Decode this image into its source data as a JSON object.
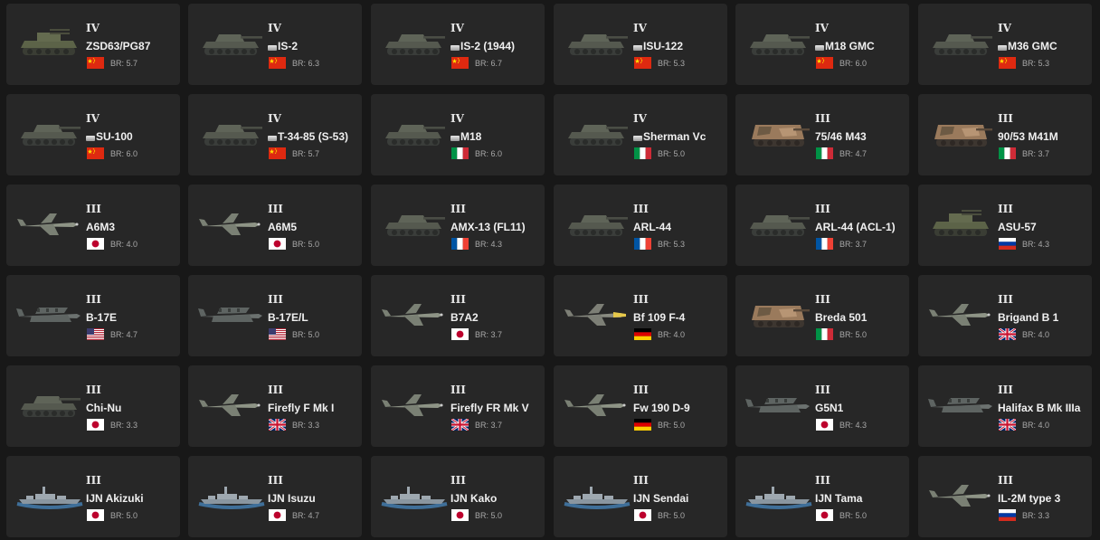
{
  "vehicles": [
    {
      "rank": "IV",
      "name": "ZSD63/PG87",
      "br": "BR: 5.7",
      "country": "china",
      "premium": false,
      "type": "tank-spaa"
    },
    {
      "rank": "IV",
      "name": "IS-2",
      "br": "BR: 6.3",
      "country": "china",
      "premium": true,
      "type": "tank"
    },
    {
      "rank": "IV",
      "name": "IS-2 (1944)",
      "br": "BR: 6.7",
      "country": "china",
      "premium": true,
      "type": "tank"
    },
    {
      "rank": "IV",
      "name": "ISU-122",
      "br": "BR: 5.3",
      "country": "china",
      "premium": true,
      "type": "tank"
    },
    {
      "rank": "IV",
      "name": "M18 GMC",
      "br": "BR: 6.0",
      "country": "china",
      "premium": true,
      "type": "tank"
    },
    {
      "rank": "IV",
      "name": "M36 GMC",
      "br": "BR: 5.3",
      "country": "china",
      "premium": true,
      "type": "tank"
    },
    {
      "rank": "IV",
      "name": "SU-100",
      "br": "BR: 6.0",
      "country": "china",
      "premium": true,
      "type": "tank"
    },
    {
      "rank": "IV",
      "name": "T-34-85 (S-53)",
      "br": "BR: 5.7",
      "country": "china",
      "premium": true,
      "type": "tank"
    },
    {
      "rank": "IV",
      "name": "M18",
      "br": "BR: 6.0",
      "country": "italy",
      "premium": true,
      "type": "tank"
    },
    {
      "rank": "IV",
      "name": "Sherman Vc",
      "br": "BR: 5.0",
      "country": "italy",
      "premium": true,
      "type": "tank"
    },
    {
      "rank": "III",
      "name": "75/46 M43",
      "br": "BR: 4.7",
      "country": "italy",
      "premium": false,
      "type": "tank-camo"
    },
    {
      "rank": "III",
      "name": "90/53 M41M",
      "br": "BR: 3.7",
      "country": "italy",
      "premium": false,
      "type": "tank-camo"
    },
    {
      "rank": "III",
      "name": "A6M3",
      "br": "BR: 4.0",
      "country": "japan",
      "premium": false,
      "type": "plane"
    },
    {
      "rank": "III",
      "name": "A6M5",
      "br": "BR: 5.0",
      "country": "japan",
      "premium": false,
      "type": "plane"
    },
    {
      "rank": "III",
      "name": "AMX-13 (FL11)",
      "br": "BR: 4.3",
      "country": "france",
      "premium": false,
      "type": "tank"
    },
    {
      "rank": "III",
      "name": "ARL-44",
      "br": "BR: 5.3",
      "country": "france",
      "premium": false,
      "type": "tank"
    },
    {
      "rank": "III",
      "name": "ARL-44 (ACL-1)",
      "br": "BR: 3.7",
      "country": "france",
      "premium": false,
      "type": "tank"
    },
    {
      "rank": "III",
      "name": "ASU-57",
      "br": "BR: 4.3",
      "country": "russia",
      "premium": false,
      "type": "tank-spaa"
    },
    {
      "rank": "III",
      "name": "B-17E",
      "br": "BR: 4.7",
      "country": "usa",
      "premium": false,
      "type": "bomber"
    },
    {
      "rank": "III",
      "name": "B-17E/L",
      "br": "BR: 5.0",
      "country": "usa",
      "premium": false,
      "type": "bomber"
    },
    {
      "rank": "III",
      "name": "B7A2",
      "br": "BR: 3.7",
      "country": "japan",
      "premium": false,
      "type": "plane"
    },
    {
      "rank": "III",
      "name": "Bf 109 F-4",
      "br": "BR: 4.0",
      "country": "germany",
      "premium": false,
      "type": "plane-yellow"
    },
    {
      "rank": "III",
      "name": "Breda 501",
      "br": "BR: 5.0",
      "country": "italy",
      "premium": false,
      "type": "tank-camo"
    },
    {
      "rank": "III",
      "name": "Brigand B 1",
      "br": "BR: 4.0",
      "country": "uk",
      "premium": false,
      "type": "plane"
    },
    {
      "rank": "III",
      "name": "Chi-Nu",
      "br": "BR: 3.3",
      "country": "japan",
      "premium": false,
      "type": "tank"
    },
    {
      "rank": "III",
      "name": "Firefly F Mk I",
      "br": "BR: 3.3",
      "country": "uk",
      "premium": false,
      "type": "plane"
    },
    {
      "rank": "III",
      "name": "Firefly FR Mk V",
      "br": "BR: 3.7",
      "country": "uk",
      "premium": false,
      "type": "plane"
    },
    {
      "rank": "III",
      "name": "Fw 190 D-9",
      "br": "BR: 5.0",
      "country": "germany",
      "premium": false,
      "type": "plane"
    },
    {
      "rank": "III",
      "name": "G5N1",
      "br": "BR: 4.3",
      "country": "japan",
      "premium": false,
      "type": "bomber"
    },
    {
      "rank": "III",
      "name": "Halifax B Mk IIIa",
      "br": "BR: 4.0",
      "country": "uk",
      "premium": false,
      "type": "bomber"
    },
    {
      "rank": "III",
      "name": "IJN Akizuki",
      "br": "BR: 5.0",
      "country": "japan",
      "premium": false,
      "type": "ship"
    },
    {
      "rank": "III",
      "name": "IJN Isuzu",
      "br": "BR: 4.7",
      "country": "japan",
      "premium": false,
      "type": "ship"
    },
    {
      "rank": "III",
      "name": "IJN Kako",
      "br": "BR: 5.0",
      "country": "japan",
      "premium": false,
      "type": "ship"
    },
    {
      "rank": "III",
      "name": "IJN Sendai",
      "br": "BR: 5.0",
      "country": "japan",
      "premium": false,
      "type": "ship"
    },
    {
      "rank": "III",
      "name": "IJN Tama",
      "br": "BR: 5.0",
      "country": "japan",
      "premium": false,
      "type": "ship"
    },
    {
      "rank": "III",
      "name": "IL-2M type 3",
      "br": "BR: 3.3",
      "country": "russia",
      "premium": false,
      "type": "plane"
    }
  ]
}
